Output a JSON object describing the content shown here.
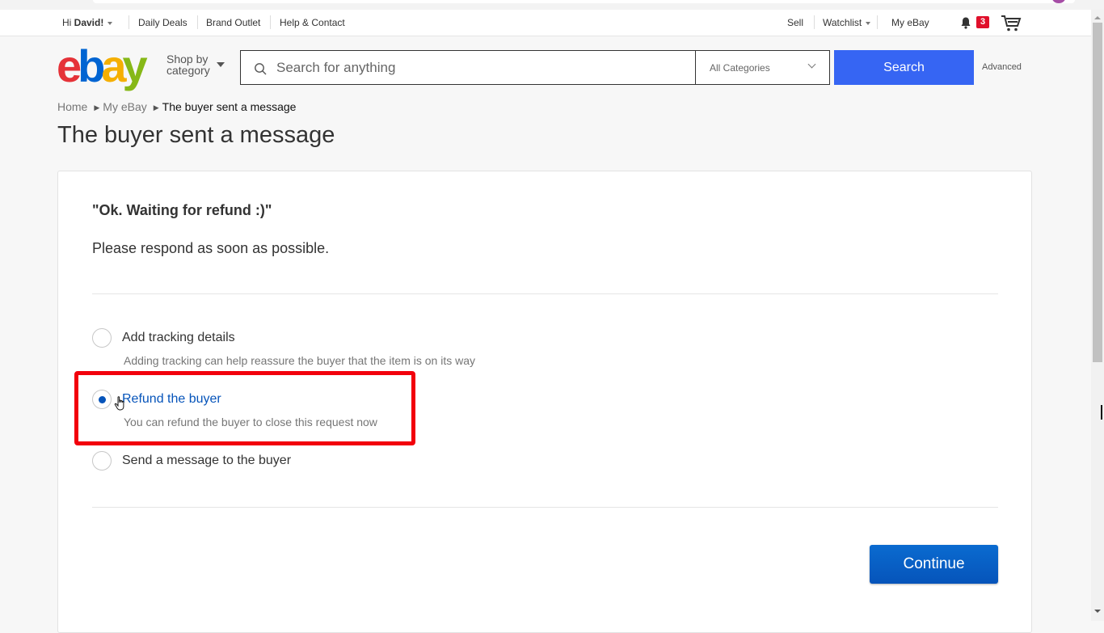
{
  "topbar": {
    "greeting_prefix": "Hi ",
    "user_name": "David!",
    "links": [
      "Daily Deals",
      "Brand Outlet",
      "Help & Contact"
    ],
    "sell": "Sell",
    "watchlist": "Watchlist",
    "my_ebay": "My eBay",
    "notification_count": "3"
  },
  "header": {
    "logo_letters": [
      "e",
      "b",
      "a",
      "y"
    ],
    "shop_by_line1": "Shop by",
    "shop_by_line2": "category",
    "search_placeholder": "Search for anything",
    "search_value": "",
    "category_selected": "All Categories",
    "search_button": "Search",
    "advanced_link": "Advanced"
  },
  "breadcrumb": {
    "items": [
      "Home",
      "My eBay",
      "The buyer sent a message"
    ]
  },
  "page_title": "The buyer sent a message",
  "card": {
    "buyer_message": "\"Ok. Waiting for refund :)\"",
    "prompt": "Please respond as soon as possible.",
    "options": [
      {
        "label": "Add tracking details",
        "description": "Adding tracking can help reassure the buyer that the item is on its way",
        "selected": false
      },
      {
        "label": "Refund the buyer",
        "description": "You can refund the buyer to close this request now",
        "selected": true
      },
      {
        "label": "Send a message to the buyer",
        "description": "",
        "selected": false
      }
    ],
    "continue_button": "Continue"
  },
  "colors": {
    "accent_blue": "#3665f3",
    "selected_blue": "#0654ba",
    "highlight_red": "#f2000c",
    "badge_red": "#e0102b"
  }
}
